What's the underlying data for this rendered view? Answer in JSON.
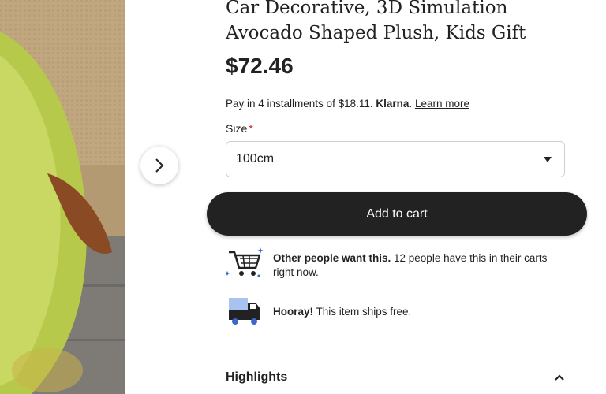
{
  "product": {
    "title": "Car Decorative, 3D Simulation Avocado Shaped Plush, Kids Gift",
    "price": "$72.46"
  },
  "klarna": {
    "prefix": "Pay in 4 installments of $18.11.",
    "brand": "Klarna",
    "period": ".",
    "link": "Learn more"
  },
  "size": {
    "label": "Size",
    "required_mark": "*",
    "selected": "100cm"
  },
  "cart": {
    "label": "Add to cart"
  },
  "notices": {
    "demand": {
      "bold": "Other people want this.",
      "rest": " 12 people have this in their carts right now.",
      "icon": "cart-icon"
    },
    "shipping": {
      "bold": "Hooray!",
      "rest": " This item ships free.",
      "icon": "truck-icon"
    }
  },
  "highlights": {
    "label": "Highlights",
    "icon": "chevron-up-icon"
  },
  "colors": {
    "accent_dark": "#222222",
    "required": "#c41a1a",
    "cart_blue": "#3c67c7"
  }
}
